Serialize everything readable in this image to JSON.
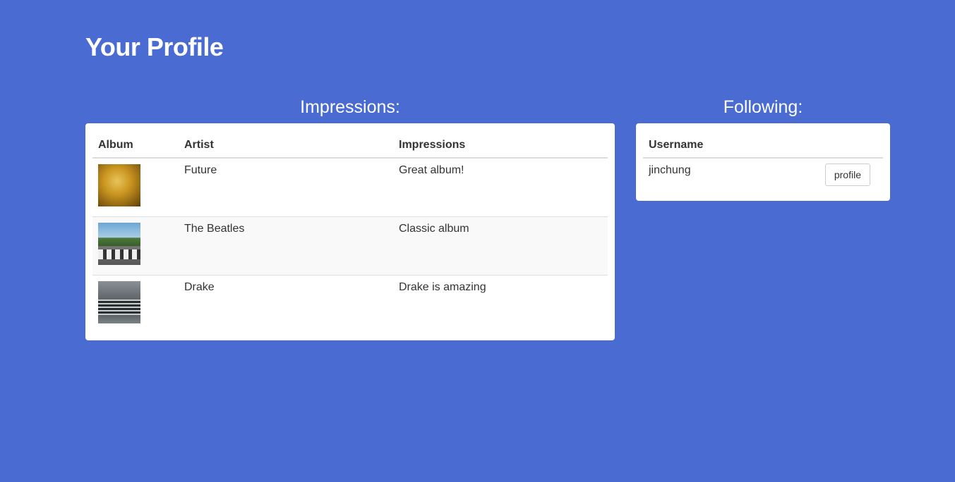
{
  "page": {
    "title": "Your Profile"
  },
  "impressions": {
    "heading": "Impressions:",
    "columns": {
      "album": "Album",
      "artist": "Artist",
      "impressions": "Impressions"
    },
    "rows": [
      {
        "album_art": "future-album-cover",
        "artist": "Future",
        "impression": "Great album!"
      },
      {
        "album_art": "abbey-road-album-cover",
        "artist": "The Beatles",
        "impression": "Classic album"
      },
      {
        "album_art": "views-album-cover",
        "artist": "Drake",
        "impression": "Drake is amazing"
      }
    ]
  },
  "following": {
    "heading": "Following:",
    "columns": {
      "username": "Username"
    },
    "rows": [
      {
        "username": "jinchung",
        "button_label": "profile"
      }
    ]
  },
  "colors": {
    "background": "#4a6bd1",
    "card": "#ffffff",
    "text": "#333333"
  }
}
